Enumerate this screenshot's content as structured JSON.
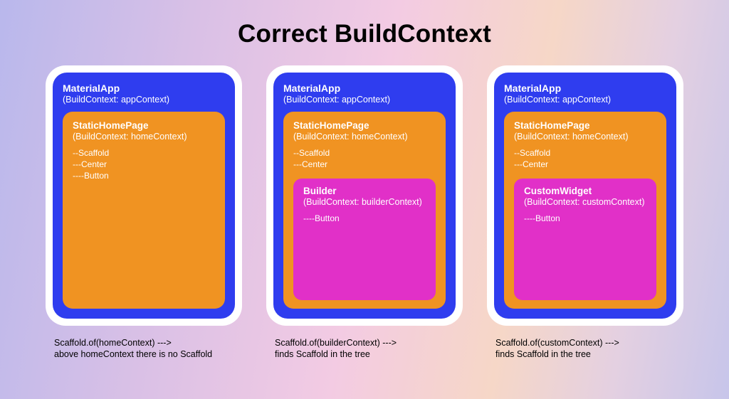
{
  "title": "Correct BuildContext",
  "columns": [
    {
      "outer": {
        "title": "MaterialApp",
        "sub": "(BuildContext: appContext)"
      },
      "orange": {
        "title": "StaticHomePage",
        "sub": "(BuildContext: homeContext)",
        "l1": "--Scaffold",
        "l2": "---Center",
        "l3": "----Button"
      },
      "magenta": null,
      "caption": "Scaffold.of(homeContext) --->\nabove homeContext there is no Scaffold"
    },
    {
      "outer": {
        "title": "MaterialApp",
        "sub": "(BuildContext: appContext)"
      },
      "orange": {
        "title": "StaticHomePage",
        "sub": "(BuildContext: homeContext)",
        "l1": "--Scaffold",
        "l2": "---Center",
        "l3": ""
      },
      "magenta": {
        "title": "Builder",
        "sub": "(BuildContext: builderContext)",
        "l1": "----Button"
      },
      "caption": "Scaffold.of(builderContext) --->\nfinds Scaffold in the tree"
    },
    {
      "outer": {
        "title": "MaterialApp",
        "sub": "(BuildContext: appContext)"
      },
      "orange": {
        "title": "StaticHomePage",
        "sub": "(BuildContext: homeContext)",
        "l1": "--Scaffold",
        "l2": "---Center",
        "l3": ""
      },
      "magenta": {
        "title": "CustomWidget",
        "sub": "(BuildContext: customContext)",
        "l1": "----Button"
      },
      "caption": "Scaffold.of(customContext) --->\nfinds Scaffold in the tree"
    }
  ]
}
